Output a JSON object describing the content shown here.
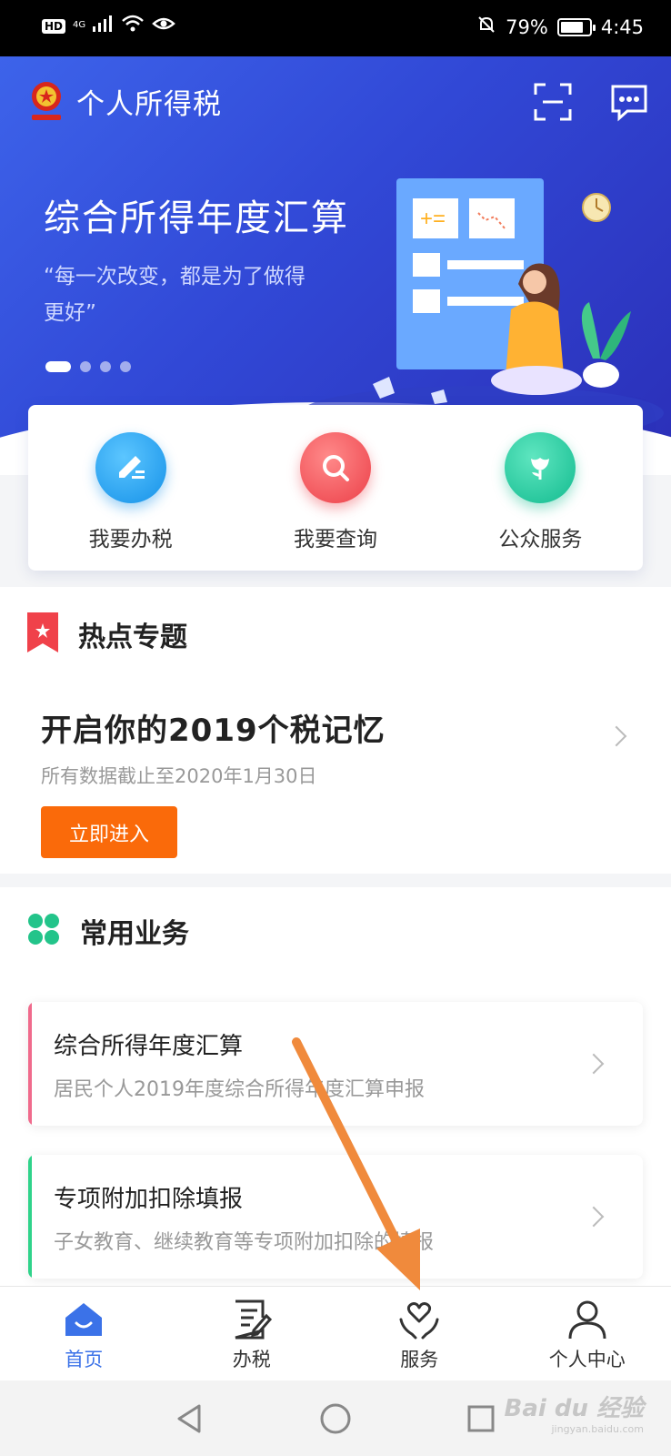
{
  "status_bar": {
    "hd": "HD",
    "network": "4G",
    "battery_pct": "79%",
    "battery_level": 0.79,
    "time": "4:45"
  },
  "header": {
    "app_title": "个人所得税"
  },
  "banner": {
    "title": "综合所得年度汇算",
    "subtitle": "“每一次改变，都是为了做得更好”",
    "slide_count": 4,
    "active_slide": 1
  },
  "quick_actions": [
    {
      "label": "我要办税",
      "icon": "pen-icon",
      "color": "#1fa3f0"
    },
    {
      "label": "我要查询",
      "icon": "search-icon",
      "color": "#f2545b"
    },
    {
      "label": "公众服务",
      "icon": "tulip-icon",
      "color": "#1fc9a0"
    }
  ],
  "hot_topics": {
    "heading": "热点专题",
    "title": "开启你的2019个税记忆",
    "subtitle": "所有数据截止至2020年1月30日",
    "button": "立即进入"
  },
  "common_business": {
    "heading": "常用业务",
    "items": [
      {
        "title": "综合所得年度汇算",
        "subtitle": "居民个人2019年度综合所得年度汇算申报",
        "accent": "#f06a8c"
      },
      {
        "title": "专项附加扣除填报",
        "subtitle": "子女教育、继续教育等专项附加扣除的填报",
        "accent": "#2fd38a"
      }
    ]
  },
  "tab_bar": [
    {
      "label": "首页",
      "icon": "home-icon",
      "active": true
    },
    {
      "label": "办税",
      "icon": "form-icon",
      "active": false
    },
    {
      "label": "服务",
      "icon": "heart-hands-icon",
      "active": false
    },
    {
      "label": "个人中心",
      "icon": "person-icon",
      "active": false
    }
  ],
  "watermark": {
    "brand": "Bai du 经验",
    "url": "jingyan.baidu.com"
  },
  "colors": {
    "accent_blue": "#3b72e8",
    "orange": "#fa6a0a",
    "annotation_arrow": "#f08a3c"
  }
}
